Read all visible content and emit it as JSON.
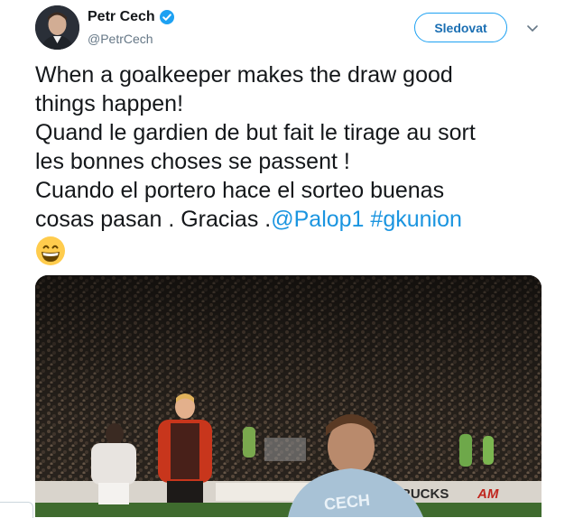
{
  "author": {
    "name": "Petr Cech",
    "handle": "@PetrCech",
    "verified": true,
    "avatar_icon": "profile-photo"
  },
  "actions": {
    "follow_label": "Sledovat",
    "menu_icon": "chevron-down-icon"
  },
  "tweet": {
    "lines": [
      "When a goalkeeper makes the draw good",
      "things happen!",
      "Quand le gardien de but fait le tirage au sort",
      "les bonnes choses se passent !",
      "Cuando el portero hace el sorteo buenas"
    ],
    "last_line_prefix": "cosas pasan . Gracias .",
    "mention": "@Palop1",
    "hashtag": "#gkunion",
    "emoji": "grinning-face-emoji"
  },
  "media": {
    "description_icon": "photo-attachment",
    "jersey_text": "CECH",
    "board_text_1": "RUCKS",
    "board_text_2": "AM"
  },
  "colors": {
    "link": "#1b95e0",
    "follow_border": "#1da1f2",
    "verified": "#1da1f2"
  }
}
